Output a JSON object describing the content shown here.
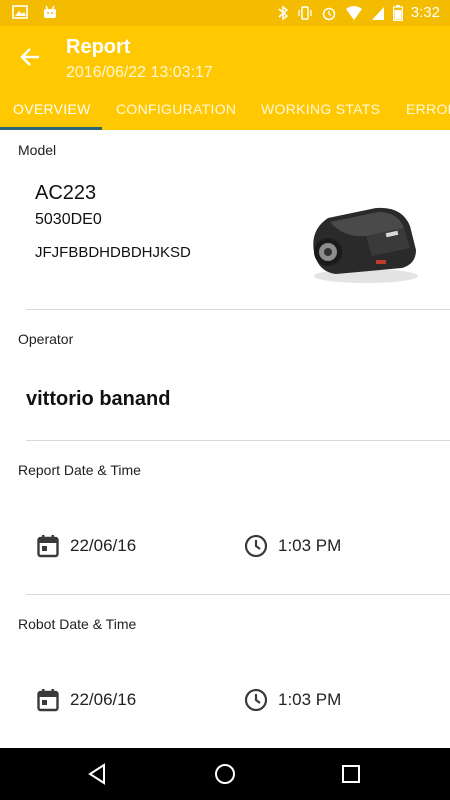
{
  "status_bar": {
    "time": "3:32"
  },
  "app_bar": {
    "title": "Report",
    "subtitle": "2016/06/22 13:03:17",
    "tabs": [
      {
        "label": "OVERVIEW",
        "active": true
      },
      {
        "label": "CONFIGURATION",
        "active": false
      },
      {
        "label": "WORKING STATS",
        "active": false
      },
      {
        "label": "ERRORS",
        "active": false
      }
    ]
  },
  "model": {
    "label": "Model",
    "name": "AC223",
    "code": "5030DE0",
    "serial": "JFJFBBDHDBDHJKSD",
    "image_icon": "robotic-lawn-mower"
  },
  "operator": {
    "label": "Operator",
    "name": "vittorio banand"
  },
  "report_datetime": {
    "label": "Report Date & Time",
    "date": "22/06/16",
    "time": "1:03 PM"
  },
  "robot_datetime": {
    "label": "Robot Date & Time",
    "date": "22/06/16",
    "time": "1:03 PM"
  },
  "colors": {
    "accent": "#ffc800",
    "status_bar": "#f3bc00",
    "tab_indicator": "#2f6676"
  }
}
